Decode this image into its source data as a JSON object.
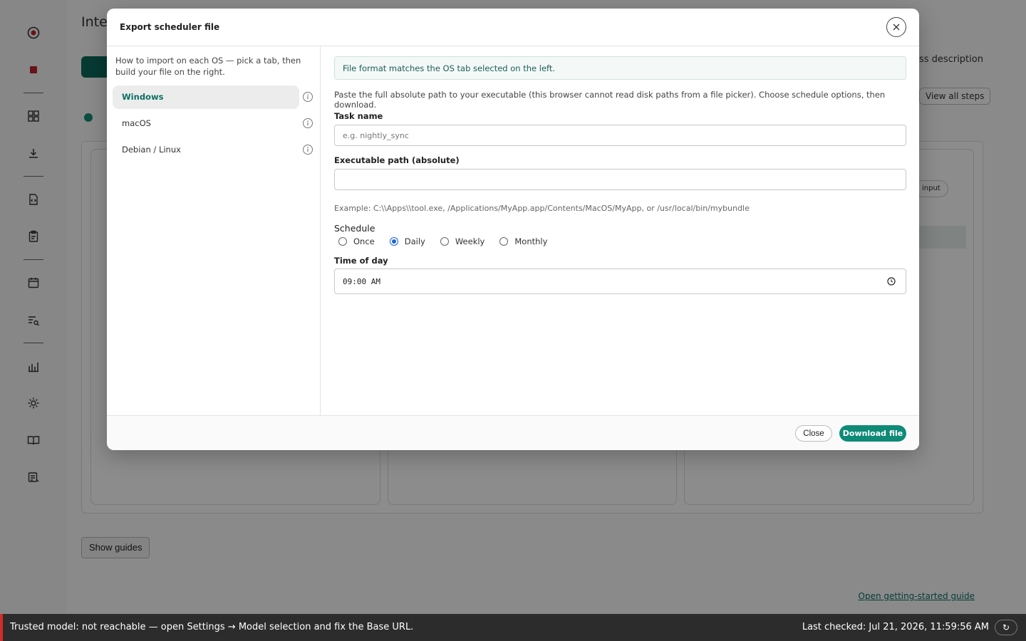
{
  "background": {
    "page_title": "Inte",
    "right_link": "ss description",
    "view_all_steps": "View all steps",
    "chip_label": "input",
    "show_guides": "Show guides",
    "open_guide": "Open getting-started guide"
  },
  "status_bar": {
    "message": "Trusted model: not reachable — open Settings → Model selection and fix the Base URL.",
    "last_checked": "Last checked: Jul 21, 2026, 11:59:56 AM",
    "refresh_icon": "refresh-icon"
  },
  "modal": {
    "title": "Export scheduler file",
    "sidebar_hint": "How to import on each OS — pick a tab, then build your file on the right.",
    "tabs": [
      {
        "label": "Windows",
        "active": true
      },
      {
        "label": "macOS",
        "active": false
      },
      {
        "label": "Debian / Linux",
        "active": false
      }
    ],
    "banner": "File format matches the OS tab selected on the left.",
    "instructions": "Paste the full absolute path to your executable (this browser cannot read disk paths from a file picker). Choose schedule options, then download.",
    "task_name": {
      "label": "Task name",
      "value": "",
      "placeholder": "e.g. nightly_sync"
    },
    "exec_path": {
      "label": "Executable path (absolute)",
      "value": "",
      "placeholder": ""
    },
    "example": "Example: C:\\\\Apps\\\\tool.exe, /Applications/MyApp.app/Contents/MacOS/MyApp, or /usr/local/bin/mybundle",
    "schedule": {
      "label": "Schedule",
      "options": [
        "Once",
        "Daily",
        "Weekly",
        "Monthly"
      ],
      "selected": "Daily"
    },
    "time_of_day": {
      "label": "Time of day",
      "value": "09:00 AM"
    },
    "footer": {
      "close": "Close",
      "download": "Download file"
    }
  },
  "colors": {
    "accent": "#0e8a77",
    "accent_dark": "#0c6a5c",
    "error": "#d12b2b",
    "radio_selected": "#1a66d8"
  }
}
